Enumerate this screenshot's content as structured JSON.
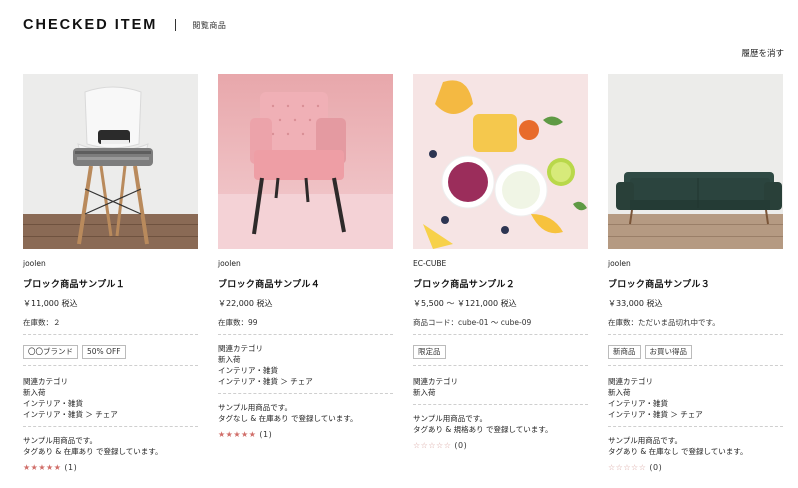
{
  "header": {
    "title": "CHECKED ITEM",
    "subtitle": "閲覧商品"
  },
  "clear_history": "履歴を消す",
  "products": [
    {
      "shop": "joolen",
      "name": "ブロック商品サンプル１",
      "price": "￥11,000 税込",
      "stock": "在庫数：２",
      "tags": [
        "〇〇ブランド",
        "50% OFF"
      ],
      "categories": [
        "関連カテゴリ",
        "新入荷",
        "インテリア・雑貨",
        "インテリア・雑貨 ＞ チェア"
      ],
      "description": [
        "サンプル用商品です。",
        "タグあり & 在庫あり で登録しています。"
      ],
      "stars": "★★★★★",
      "review_count": "(1)"
    },
    {
      "shop": "joolen",
      "name": "ブロック商品サンプル４",
      "price": "￥22,000 税込",
      "stock": "在庫数：99",
      "tags": [],
      "categories": [
        "関連カテゴリ",
        "新入荷",
        "インテリア・雑貨",
        "インテリア・雑貨 ＞ チェア"
      ],
      "description": [
        "サンプル用商品です。",
        "タグなし & 在庫あり で登録しています。"
      ],
      "stars": "★★★★★",
      "review_count": "(1)"
    },
    {
      "shop": "EC-CUBE",
      "name": "ブロック商品サンプル２",
      "price": "￥5,500 ～ ￥121,000 税込",
      "stock": "商品コード：cube-01 ～ cube-09",
      "tags": [
        "限定品"
      ],
      "categories": [
        "関連カテゴリ",
        "新入荷"
      ],
      "description": [
        "サンプル用商品です。",
        "タグあり & 規格あり で登録しています。"
      ],
      "stars": "☆☆☆☆☆",
      "review_count": "(0)"
    },
    {
      "shop": "joolen",
      "name": "ブロック商品サンプル３",
      "price": "￥33,000 税込",
      "stock": "在庫数：ただいま品切れ中です。",
      "tags": [
        "新商品",
        "お買い得品"
      ],
      "categories": [
        "関連カテゴリ",
        "新入荷",
        "インテリア・雑貨",
        "インテリア・雑貨 ＞ チェア"
      ],
      "description": [
        "サンプル用商品です。",
        "タグあり & 在庫なし で登録しています。"
      ],
      "stars": "☆☆☆☆☆",
      "review_count": "(0)"
    }
  ]
}
